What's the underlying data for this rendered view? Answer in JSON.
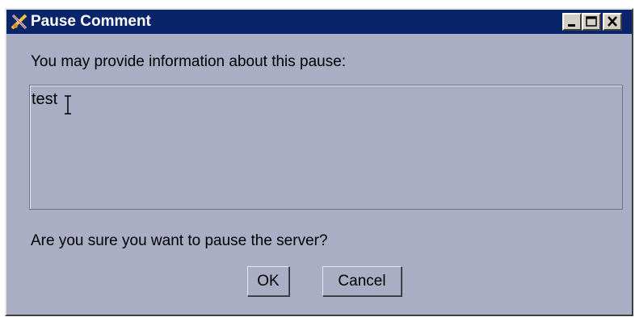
{
  "window": {
    "title": "Pause Comment",
    "controls": [
      "minimize",
      "maximize",
      "close"
    ]
  },
  "dialog": {
    "prompt": "You may provide information about this pause:",
    "comment_value": "test",
    "question": "Are you sure you want to pause the server?"
  },
  "buttons": {
    "ok_label": "OK",
    "cancel_label": "Cancel"
  },
  "colors": {
    "title_bar": "#0a246a",
    "dialog_bg": "#a9aec4"
  }
}
